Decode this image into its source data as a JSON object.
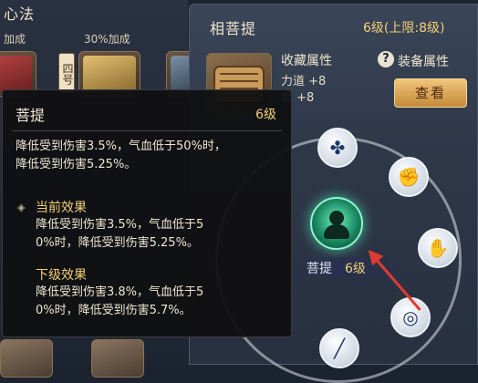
{
  "left": {
    "title": "心法",
    "bonus_left": "加成",
    "bonus_right": "30%加成",
    "tag": "四号"
  },
  "treasure": {
    "title": "相菩提",
    "level": "6级(上限:8级)",
    "collect_attr_label": "收藏属性",
    "attrs": [
      "力道 +8",
      "骨 +8"
    ],
    "equip_attr_label": "装备属性",
    "help_icon": "?",
    "view_button": "查看"
  },
  "skill": {
    "name": "菩提",
    "level": "6级"
  },
  "tooltip": {
    "title": "菩提",
    "level": "6级",
    "description": "降低受到伤害3.5%，气血低于50%时，\n降低受到伤害5.25%。",
    "current_label": "当前效果",
    "current_text": "降低受到伤害3.5%，气血低于5\n0%时，降低受到伤害5.25%。",
    "next_label": "下级效果",
    "next_text": "降低受到伤害3.8%，气血低于5\n0%时，降低受到伤害5.7%。"
  },
  "icons": {
    "node_top": "shield-pattern-icon",
    "node_upper_right": "fist-icon",
    "node_right": "palm-icon",
    "node_lower_right": "ring-circle-icon",
    "node_bottom": "staff-icon",
    "center": "meditating-figure-icon"
  },
  "colors": {
    "accent_gold": "#f2cf73",
    "annotation_arrow": "#e23b2f",
    "center_glow": "#6ef0c0"
  }
}
